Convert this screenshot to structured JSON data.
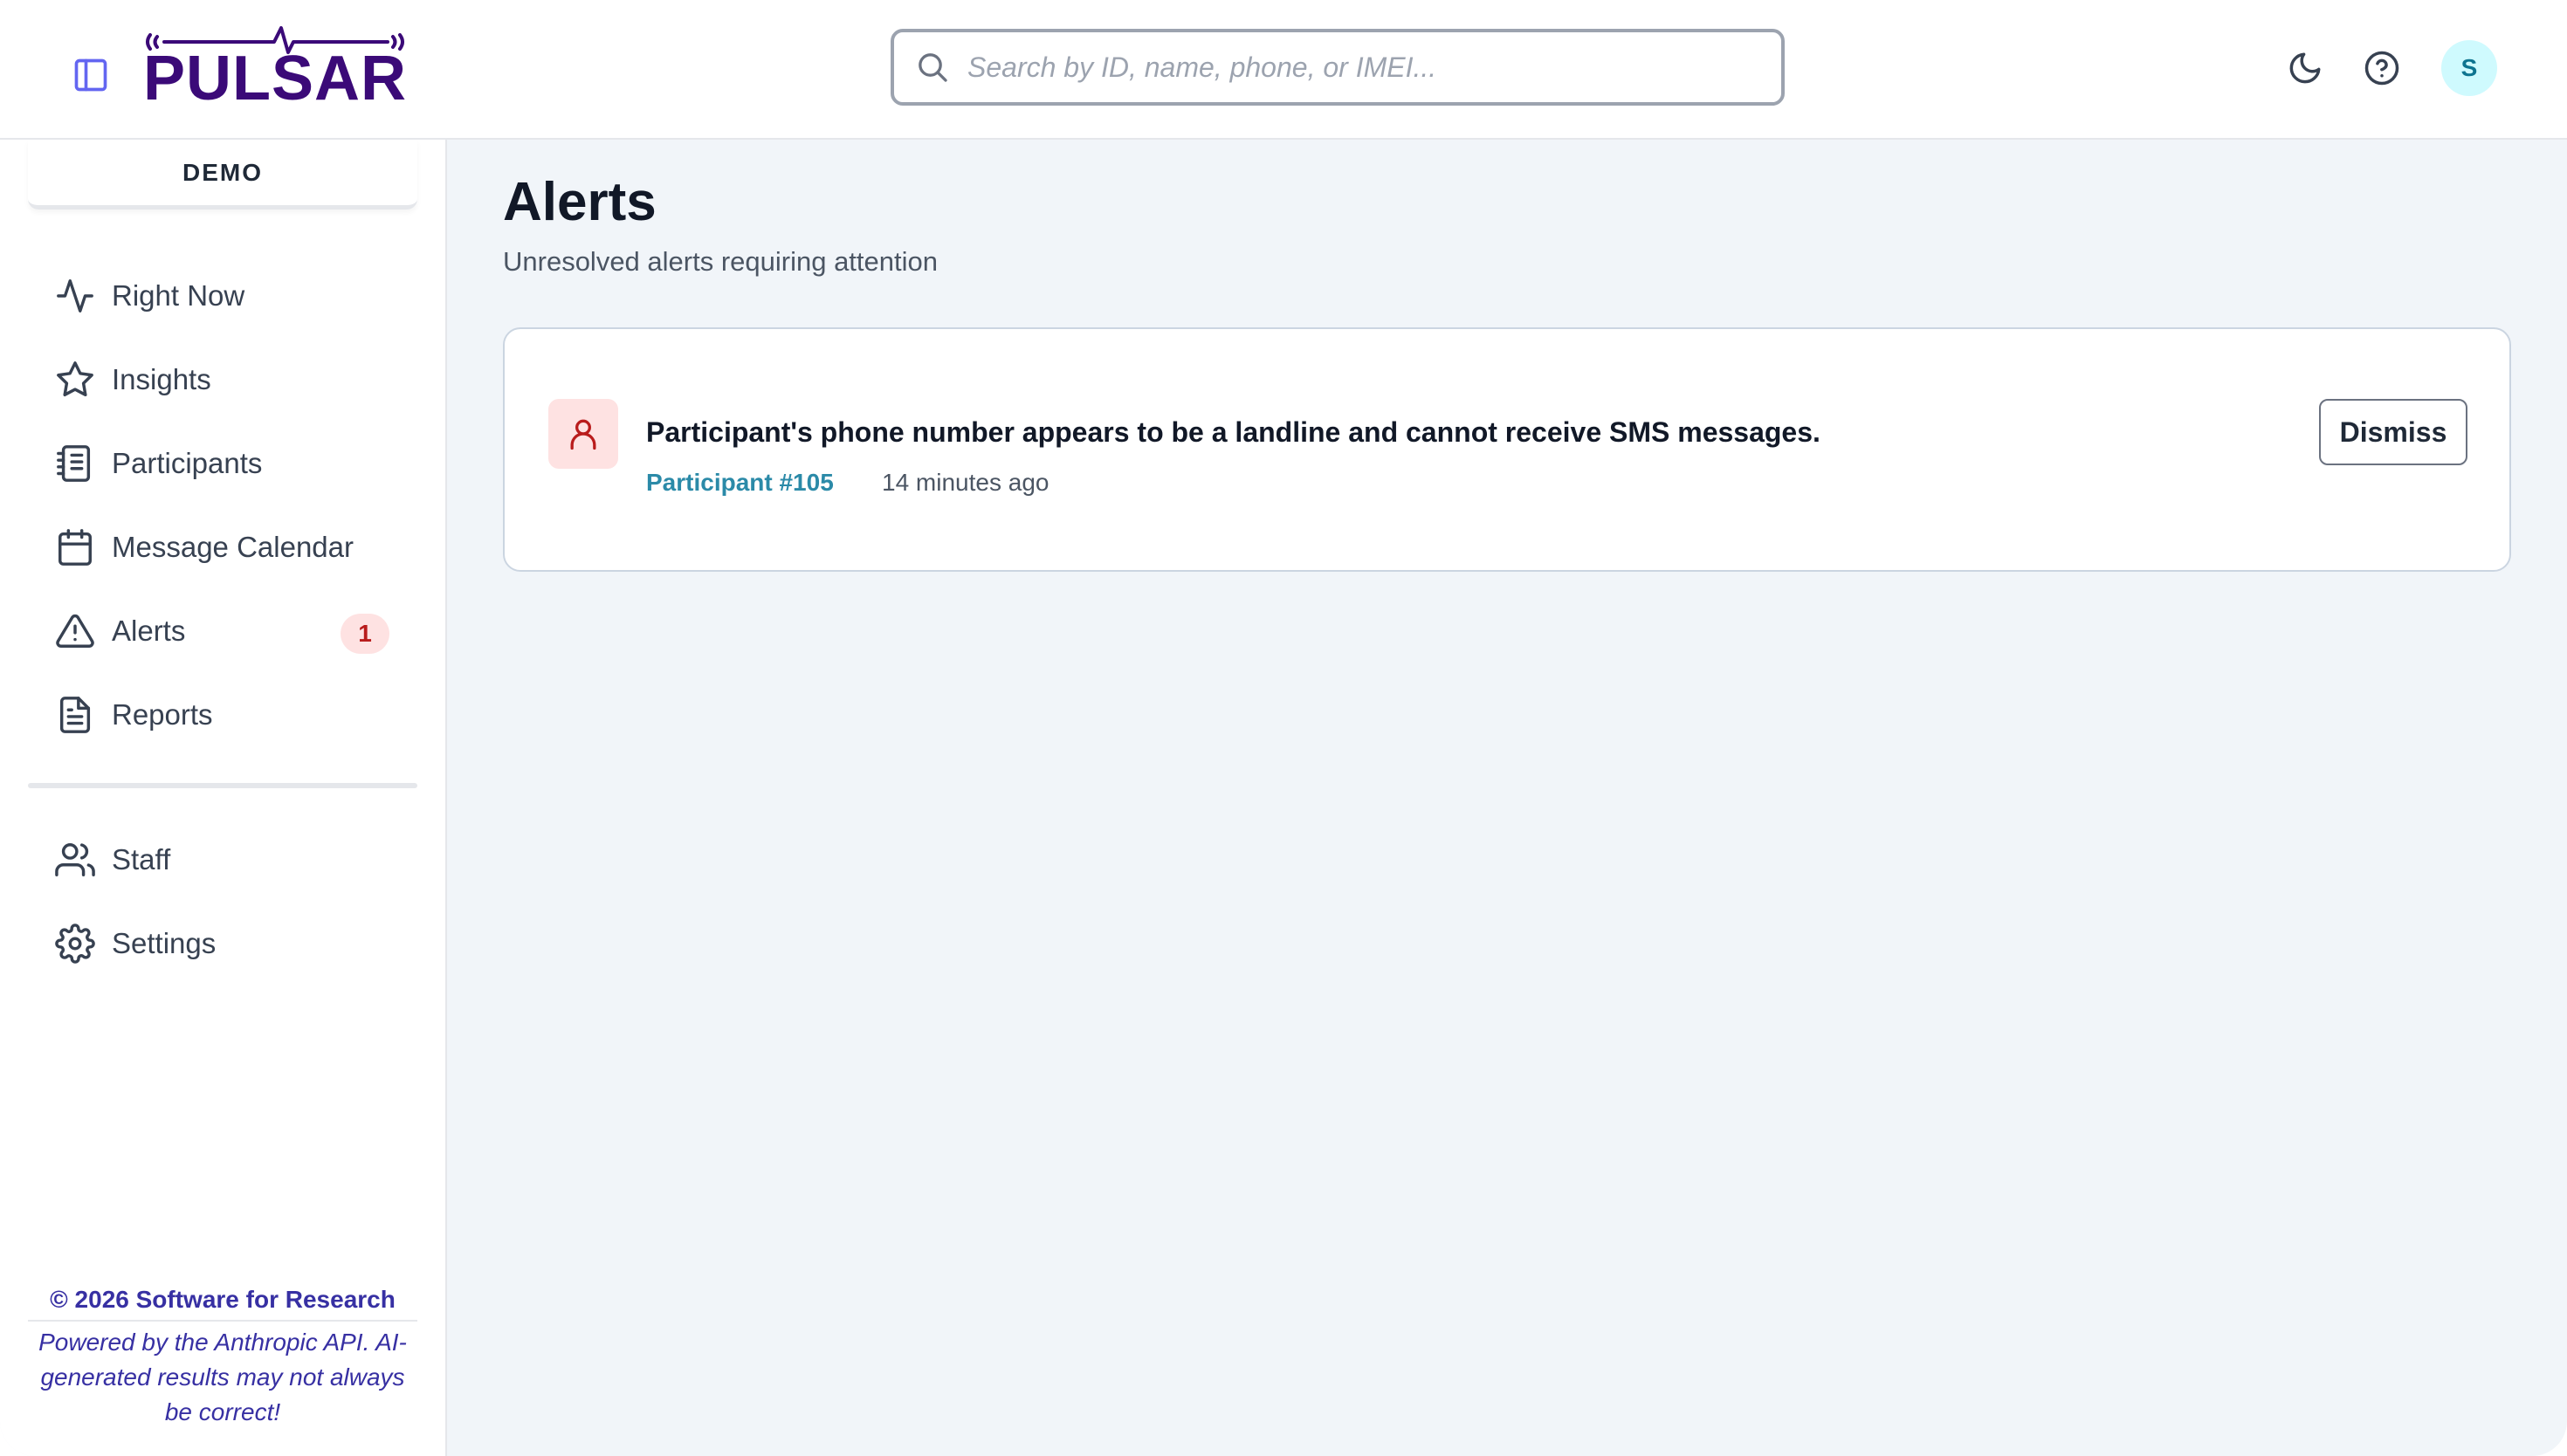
{
  "header": {
    "logo_text": "PULSAR",
    "search_placeholder": "Search by ID, name, phone, or IMEI...",
    "avatar_initial": "S",
    "icons": [
      "sidebar-toggle-icon",
      "search-icon",
      "moon-icon",
      "help-icon"
    ]
  },
  "sidebar": {
    "workspace": "DEMO",
    "items": [
      {
        "label": "Right Now",
        "icon": "activity-icon"
      },
      {
        "label": "Insights",
        "icon": "star-icon"
      },
      {
        "label": "Participants",
        "icon": "notebook-icon"
      },
      {
        "label": "Message Calendar",
        "icon": "calendar-icon"
      },
      {
        "label": "Alerts",
        "icon": "warning-icon",
        "badge": "1"
      },
      {
        "label": "Reports",
        "icon": "document-icon"
      },
      {
        "label": "Staff",
        "icon": "users-icon"
      },
      {
        "label": "Settings",
        "icon": "gear-icon"
      }
    ],
    "footer_copyright": "© 2026 Software for Research",
    "footer_note": "Powered by the Anthropic API. AI-generated results may not always be correct!"
  },
  "main": {
    "title": "Alerts",
    "subtitle": "Unresolved alerts requiring attention",
    "alerts": [
      {
        "message": "Participant's phone number appears to be a landline and cannot receive SMS messages.",
        "participant": "Participant #105",
        "time": "14 minutes ago",
        "action": "Dismiss",
        "icon": "user-icon"
      }
    ]
  },
  "colors": {
    "brand": "#3b0a78",
    "accent_link": "#2b8aa8",
    "alert_badge_bg": "#fee2e2",
    "alert_badge_fg": "#b91c1c",
    "footer_text": "#3730a3",
    "page_bg": "#f1f5f9"
  }
}
